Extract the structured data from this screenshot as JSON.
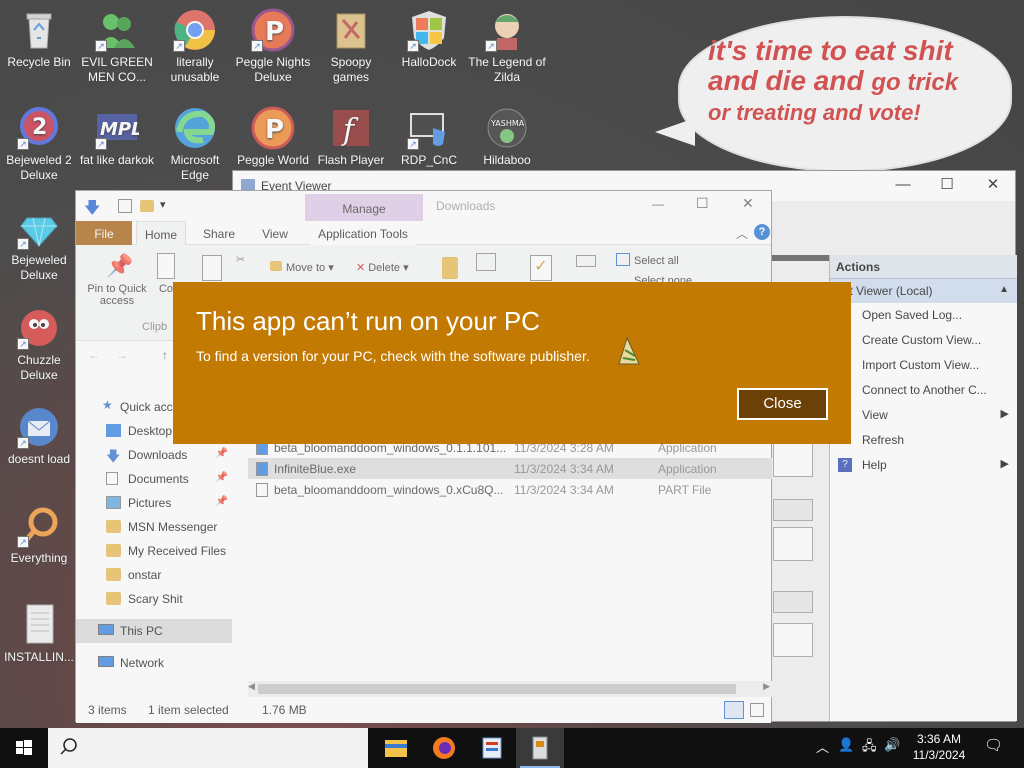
{
  "desktop": {
    "icons": [
      {
        "label": "Recycle Bin",
        "icon": "recycle-bin-icon"
      },
      {
        "label": "EVIL GREEN MEN CO...",
        "icon": "messenger-icon"
      },
      {
        "label": "literally unusable",
        "icon": "chrome-icon"
      },
      {
        "label": "Peggle Nights Deluxe",
        "icon": "peggle-icon"
      },
      {
        "label": "Spoopy games",
        "icon": "folder-icon"
      },
      {
        "label": "HalloDock",
        "icon": "windows-shield-icon"
      },
      {
        "label": "The Legend of Zilda",
        "icon": "game-icon"
      },
      {
        "label": "Bejeweled 2 Deluxe",
        "icon": "bejeweled-icon"
      },
      {
        "label": "fat like darkok",
        "icon": "mpl-icon"
      },
      {
        "label": "Microsoft Edge",
        "icon": "edge-icon"
      },
      {
        "label": "Peggle World",
        "icon": "peggle-icon"
      },
      {
        "label": "Flash Player",
        "icon": "flash-icon"
      },
      {
        "label": "RDP_CnC",
        "icon": "rdp-icon"
      },
      {
        "label": "Hildaboo",
        "icon": "game-icon"
      },
      {
        "label": "Bejeweled Deluxe",
        "icon": "gem-icon"
      },
      {
        "label": "Chuzzle Deluxe",
        "icon": "chuzzle-icon"
      },
      {
        "label": "doesnt load",
        "icon": "thunderbird-icon"
      },
      {
        "label": "Everything",
        "icon": "search-ring-icon"
      },
      {
        "label": "INSTALLIN...",
        "icon": "document-icon"
      }
    ],
    "speech_bubble": {
      "line1": "it's time to eat shit",
      "line2a": "and die and ",
      "line2b": "go trick",
      "line3": "or treating and vote!"
    }
  },
  "event_viewer": {
    "title": "Event Viewer",
    "actions_header": "Actions",
    "actions_sub": "ent Viewer (Local)",
    "actions": [
      "Open Saved Log...",
      "Create Custom View...",
      "Import Custom View...",
      "Connect to Another C...",
      "View",
      "Refresh",
      "Help"
    ]
  },
  "explorer": {
    "context_tab": "Manage",
    "folder_title": "Downloads",
    "tabs": {
      "file": "File",
      "home": "Home",
      "share": "Share",
      "view": "View",
      "app_tools": "Application Tools"
    },
    "ribbon": {
      "pin": "Pin to Quick access",
      "copy": "Co",
      "clipboard": "Clipb",
      "move_to": "Move to",
      "delete": "Delete",
      "select_all": "Select all",
      "select_none": "Select none"
    },
    "nav": {
      "quick_access": "Quick acce",
      "items": [
        "Desktop",
        "Downloads",
        "Documents",
        "Pictures",
        "MSN Messenger",
        "My Received Files",
        "onstar",
        "Scary Shit"
      ],
      "this_pc": "This PC",
      "network": "Network"
    },
    "files": [
      {
        "name": "beta_bloomanddoom_windows_0.1.1.101...",
        "date": "11/3/2024 3:28 AM",
        "type": "Application"
      },
      {
        "name": "InfiniteBlue.exe",
        "date": "11/3/2024 3:34 AM",
        "type": "Application"
      },
      {
        "name": "beta_bloomanddoom_windows_0.xCu8Q...",
        "date": "11/3/2024 3:34 AM",
        "type": "PART File"
      }
    ],
    "status": {
      "items": "3 items",
      "selected": "1 item selected",
      "size": "1.76 MB"
    }
  },
  "dialog": {
    "title": "This app can’t run on your PC",
    "message": "To find a version for your PC, check with the software publisher.",
    "close_label": "Close",
    "color": "#c37a03"
  },
  "taskbar": {
    "time": "3:36 AM",
    "date": "11/3/2024"
  }
}
